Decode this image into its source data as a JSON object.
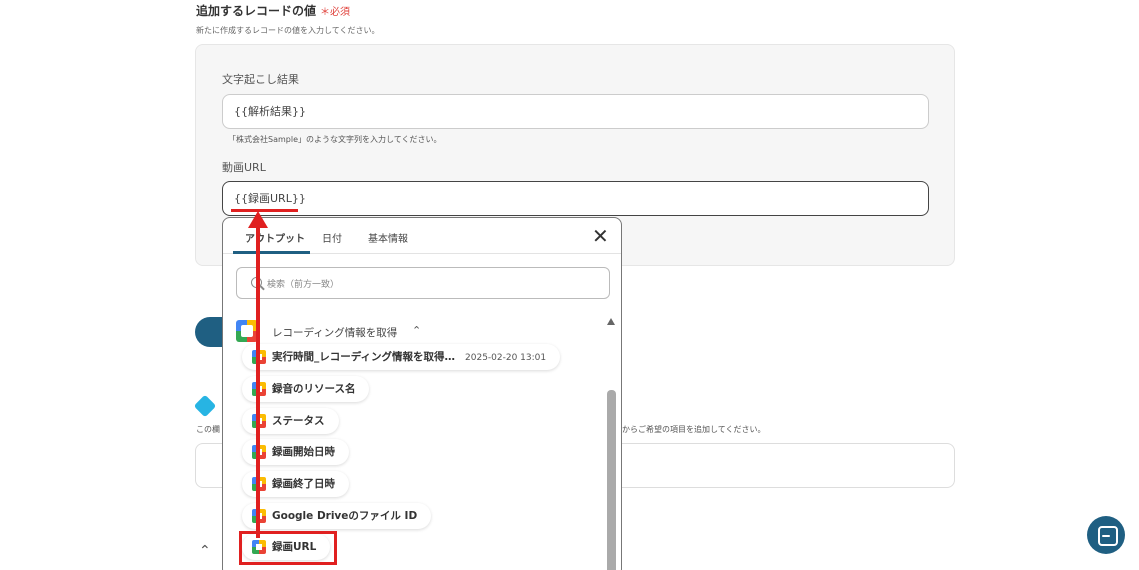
{
  "field": {
    "title": "追加するレコードの値",
    "required_label": "＊必須",
    "help": "新たに作成するレコードの値を入力してください。"
  },
  "form": {
    "field1": {
      "label": "文字起こし結果",
      "value": "{{解析結果}}",
      "hint": "「株式会社Sample」のような文字列を入力してください。"
    },
    "field2": {
      "label": "動画URL",
      "value": "{{録画URL}}"
    }
  },
  "background": {
    "help_right": "からご希望の項目を追加してください。",
    "help_left": "この欄"
  },
  "dropdown": {
    "tabs": [
      {
        "label": "アウトプット",
        "active": true
      },
      {
        "label": "日付",
        "active": false
      },
      {
        "label": "基本情報",
        "active": false
      }
    ],
    "close_icon": "close-icon",
    "search_placeholder": "検索（前方一致）",
    "section": {
      "label": "レコーディング情報を取得",
      "collapse_glyph": "⌃"
    },
    "items": [
      {
        "label": "実行時間_レコーディング情報を取得…",
        "value": "2025-02-20 13:01"
      },
      {
        "label": "録音のリソース名"
      },
      {
        "label": "ステータス"
      },
      {
        "label": "録画開始日時"
      },
      {
        "label": "録画終了日時"
      },
      {
        "label": "Google Driveのファイル ID"
      },
      {
        "label": "録画URL"
      }
    ]
  },
  "colors": {
    "accent": "#1f5f82",
    "annotation_red": "#e02020",
    "required_red": "#e0413b"
  }
}
